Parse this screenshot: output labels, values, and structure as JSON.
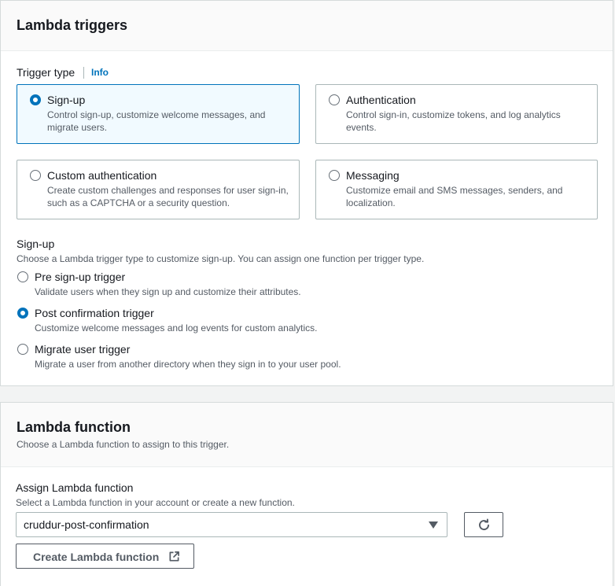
{
  "triggers_panel": {
    "title": "Lambda triggers",
    "trigger_type_label": "Trigger type",
    "info_link": "Info",
    "tiles": [
      {
        "title": "Sign-up",
        "desc": "Control sign-up, customize welcome messages, and migrate users.",
        "selected": true
      },
      {
        "title": "Authentication",
        "desc": "Control sign-in, customize tokens, and log analytics events.",
        "selected": false
      },
      {
        "title": "Custom authentication",
        "desc": "Create custom challenges and responses for user sign-in, such as a CAPTCHA or a security question.",
        "selected": false
      },
      {
        "title": "Messaging",
        "desc": "Customize email and SMS messages, senders, and localization.",
        "selected": false
      }
    ],
    "signup_section": {
      "label": "Sign-up",
      "desc": "Choose a Lambda trigger type to customize sign-up. You can assign one function per trigger type.",
      "options": [
        {
          "title": "Pre sign-up trigger",
          "desc": "Validate users when they sign up and customize their attributes.",
          "checked": false
        },
        {
          "title": "Post confirmation trigger",
          "desc": "Customize welcome messages and log events for custom analytics.",
          "checked": true
        },
        {
          "title": "Migrate user trigger",
          "desc": "Migrate a user from another directory when they sign in to your user pool.",
          "checked": false
        }
      ]
    }
  },
  "function_panel": {
    "title": "Lambda function",
    "subtitle": "Choose a Lambda function to assign to this trigger.",
    "assign_label": "Assign Lambda function",
    "assign_desc": "Select a Lambda function in your account or create a new function.",
    "selected_function": "cruddur-post-confirmation",
    "create_button": "Create Lambda function",
    "icons": {
      "refresh": "refresh-icon",
      "external": "external-link-icon",
      "dropdown": "caret-down-icon"
    }
  },
  "colors": {
    "accent": "#0073bb",
    "selected_tile_bg": "#f1faff",
    "border": "#aab7b8",
    "text": "#16191f",
    "muted": "#545b64"
  }
}
